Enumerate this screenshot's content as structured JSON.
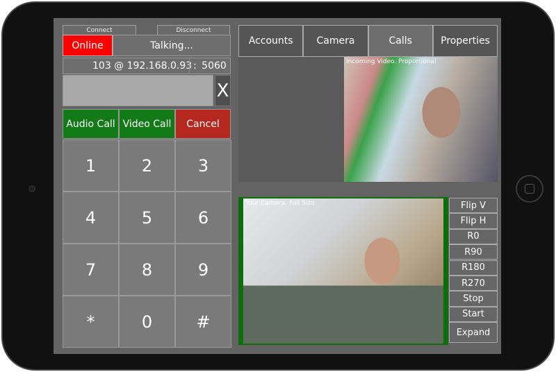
{
  "connection": {
    "connect_label": "Connect",
    "disconnect_label": "Disconnect",
    "status": "Online",
    "call_state": "Talking...",
    "account": "103 @ 192.168.0.93",
    "port_separator": ":",
    "port": "5060"
  },
  "dial": {
    "number_value": "",
    "clear_label": "X"
  },
  "call_buttons": {
    "audio": "Audio Call",
    "video": "Video Call",
    "cancel": "Cancel"
  },
  "keypad": [
    "1",
    "2",
    "3",
    "4",
    "5",
    "6",
    "7",
    "8",
    "9",
    "*",
    "0",
    "#"
  ],
  "tabs": [
    {
      "label": "Accounts"
    },
    {
      "label": "Camera"
    },
    {
      "label": "Calls",
      "active": true
    },
    {
      "label": "Properties"
    }
  ],
  "incoming_video": {
    "label": "Incoming Video. Proportional"
  },
  "local_video": {
    "label": "Your Camera. Full Size"
  },
  "camera_controls": [
    "Flip V",
    "Flip H",
    "R0",
    "R90",
    "R180",
    "R270",
    "Stop",
    "Start",
    "Expand"
  ],
  "colors": {
    "online": "#ff0000",
    "call_green": "#127a17",
    "cancel_red": "#b52820",
    "frame_green": "#0b6e0b"
  }
}
